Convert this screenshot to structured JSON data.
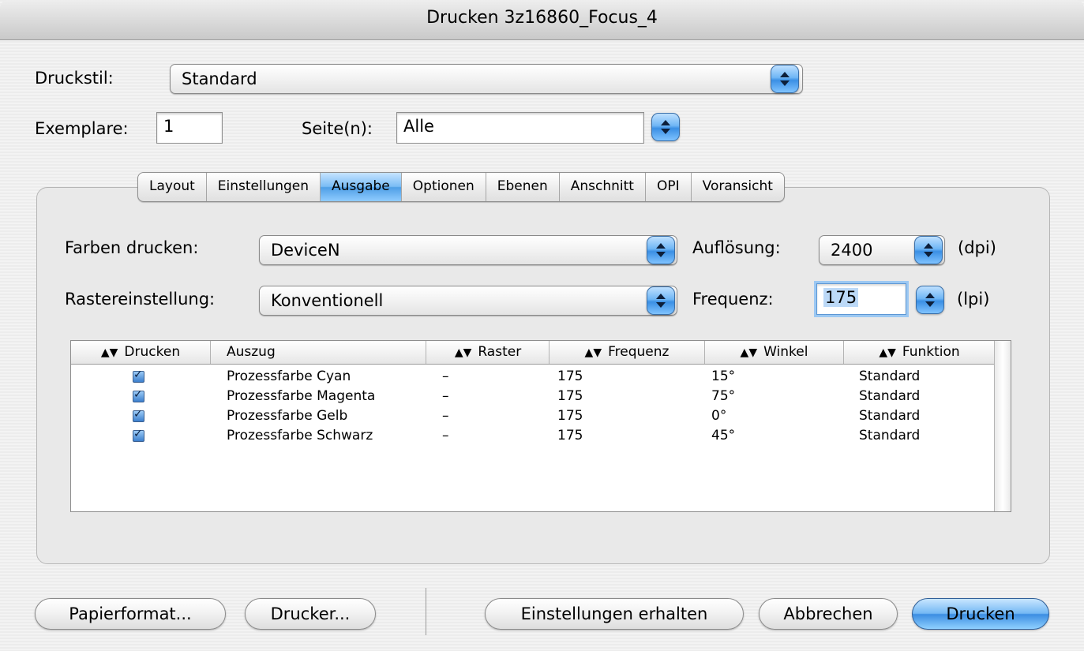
{
  "window": {
    "title": "Drucken 3z16860_Focus_4"
  },
  "top": {
    "druckstil_label": "Druckstil:",
    "druckstil_value": "Standard",
    "exemplare_label": "Exemplare:",
    "exemplare_value": "1",
    "seiten_label": "Seite(n):",
    "seiten_value": "Alle"
  },
  "tabs": [
    "Layout",
    "Einstellungen",
    "Ausgabe",
    "Optionen",
    "Ebenen",
    "Anschnitt",
    "OPI",
    "Voransicht"
  ],
  "selected_tab": "Ausgabe",
  "output": {
    "farben_label": "Farben drucken:",
    "farben_value": "DeviceN",
    "aufloesung_label": "Auflösung:",
    "aufloesung_value": "2400",
    "aufloesung_unit": "(dpi)",
    "raster_label": "Rastereinstellung:",
    "raster_value": "Konventionell",
    "frequenz_label": "Frequenz:",
    "frequenz_value": "175",
    "frequenz_unit": "(lpi)"
  },
  "table": {
    "columns": [
      "Drucken",
      "Auszug",
      "Raster",
      "Frequenz",
      "Winkel",
      "Funktion"
    ],
    "rows": [
      {
        "print": true,
        "auszug": "Prozessfarbe Cyan",
        "raster": "–",
        "frequenz": "175",
        "winkel": "15°",
        "funktion": "Standard"
      },
      {
        "print": true,
        "auszug": "Prozessfarbe Magenta",
        "raster": "–",
        "frequenz": "175",
        "winkel": "75°",
        "funktion": "Standard"
      },
      {
        "print": true,
        "auszug": "Prozessfarbe Gelb",
        "raster": "–",
        "frequenz": "175",
        "winkel": "0°",
        "funktion": "Standard"
      },
      {
        "print": true,
        "auszug": "Prozessfarbe Schwarz",
        "raster": "–",
        "frequenz": "175",
        "winkel": "45°",
        "funktion": "Standard"
      }
    ]
  },
  "buttons": {
    "papierformat": "Papierformat...",
    "drucker": "Drucker...",
    "einstellungen_erhalten": "Einstellungen erhalten",
    "abbrechen": "Abbrechen",
    "drucken": "Drucken"
  },
  "colors": {
    "accent": "#4f9fe6",
    "focus_ring": "#7fb8ec"
  }
}
